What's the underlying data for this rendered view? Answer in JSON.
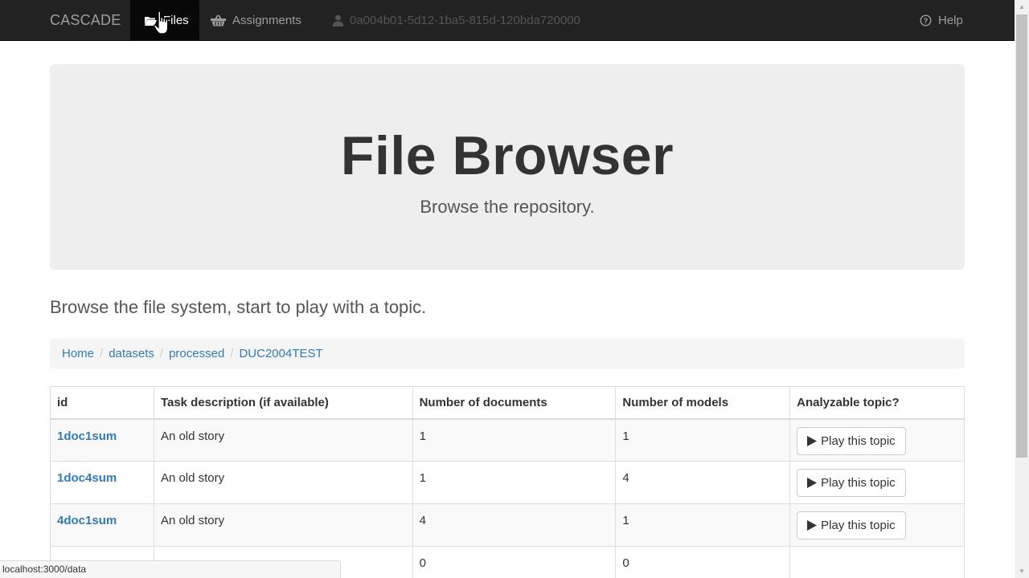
{
  "navbar": {
    "brand": "CASCADE",
    "files_label": "Files",
    "assignments_label": "Assignments",
    "user_id": "0a004b01-5d12-1ba5-815d-120bda720000",
    "help_label": "Help"
  },
  "jumbotron": {
    "title": "File Browser",
    "subtitle": "Browse the repository."
  },
  "lead": "Browse the file system, start to play with a topic.",
  "breadcrumb": [
    "Home",
    "datasets",
    "processed",
    "DUC2004TEST"
  ],
  "table": {
    "headers": [
      "id",
      "Task description (if available)",
      "Number of documents",
      "Number of models",
      "Analyzable topic?"
    ],
    "rows": [
      {
        "id": "1doc1sum",
        "desc": "An old story",
        "docs": "1",
        "models": "1",
        "action": "Play this topic"
      },
      {
        "id": "1doc4sum",
        "desc": "An old story",
        "docs": "1",
        "models": "4",
        "action": "Play this topic"
      },
      {
        "id": "4doc1sum",
        "desc": "An old story",
        "docs": "4",
        "models": "1",
        "action": "Play this topic"
      },
      {
        "id": "",
        "desc": "",
        "docs": "0",
        "models": "0",
        "action": ""
      }
    ]
  },
  "status_url": "localhost:3000/data",
  "colors": {
    "navbar_bg": "#222222",
    "link": "#337ab7",
    "jumbotron_bg": "#eeeeee"
  }
}
